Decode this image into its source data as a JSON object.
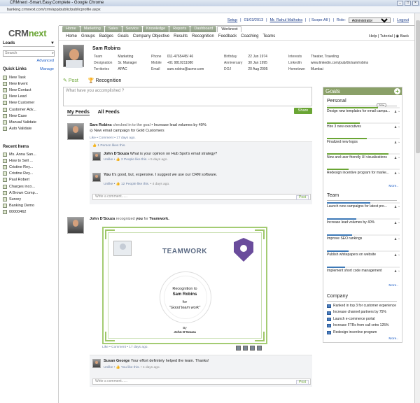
{
  "window": {
    "title": "CRMnext -Smart.Easy.Complete - Google Chrome",
    "url": "banking.crmnext.com/crm/app/public/publicprofile.aspx"
  },
  "toplinks": {
    "setup": "Setup",
    "date": "01/03/2013",
    "user": "Mr. Rahul Malhotra",
    "scope": "( Scope:All )",
    "role_label": "Role:",
    "role_value": "Administrator",
    "logout": "Logout"
  },
  "tabs": [
    "Home",
    "Marketing",
    "Sales",
    "Service",
    "Knowledge",
    "Reports",
    "Dashboard",
    "Worknext"
  ],
  "sidebar": {
    "logo_a": "CRM",
    "logo_b": "next",
    "module": "Leads",
    "search_label": "Search",
    "advanced": "Advanced",
    "quick_links_title": "Quick Links",
    "manage": "Manage",
    "quick_links": [
      "New Task",
      "New Event",
      "New Contact",
      "New Lead",
      "New Customer",
      "Customer Adv...",
      "New Case",
      "Manual Validate",
      "Auto Validate"
    ],
    "recent_title": "Recent Items",
    "recent_items": [
      "Ms. Anna San...",
      "How to Sell ...",
      "Cristine Rey...",
      "Cristine Rey...",
      "Paul Robert",
      "Charges inco...",
      "A Brown Comp...",
      "Survey",
      "Banking Demo",
      "00000462"
    ]
  },
  "nav": {
    "items": [
      "Home",
      "Groups",
      "Badges",
      "Goals",
      "Company Objective",
      "Results",
      "Recognition",
      "Feedback",
      "Coaching",
      "Teams"
    ],
    "help": "Help",
    "tutorial": "Tutorial",
    "back": "Back"
  },
  "profile": {
    "name": "Sam Robins",
    "fields1": [
      [
        "Team",
        "Marketing"
      ],
      [
        "Designation",
        "Sr. Manager"
      ],
      [
        "Territories",
        "APAC"
      ]
    ],
    "fields2": [
      [
        "Phone",
        "011-4765445/ 46"
      ],
      [
        "Mobile",
        "+91 9810211080"
      ],
      [
        "Email",
        "sam.robins@acme.com"
      ]
    ],
    "fields3": [
      [
        "Birthday",
        "22 Jun 1974"
      ],
      [
        "Anniversary",
        "30 Jan 1995"
      ],
      [
        "DOJ",
        "20 Aug 2005"
      ]
    ],
    "fields4": [
      [
        "Interests",
        "Theater, Traveling"
      ],
      [
        "LinkedIn",
        "www.linkedin.com/pub/dir/sam/robins"
      ],
      [
        "Hometown",
        "Mumbai"
      ]
    ]
  },
  "post": {
    "tab_post": "Post",
    "tab_recognition": "Recognition",
    "placeholder": "What have you accomplished ?",
    "share": "Share"
  },
  "feedtabs": {
    "my": "My Feeds",
    "all": "All Feeds"
  },
  "feed1": {
    "author": "Sam Robins",
    "action": "checked in to the goal",
    "goal": "Increase lead volumes by 40%",
    "sub": "New email campaign for Gold Customers",
    "meta": "Like • Comment • 17 days ago.",
    "likes": "1 Person likes this.",
    "c1_author": "John D'Souza",
    "c1_text": "What is your opinion on Hub Spot's email strategy?",
    "c1_meta_a": "Unlike •",
    "c1_meta_b": "2 People like this.",
    "c1_meta_c": "• 5 days ago.",
    "c2_author": "You",
    "c2_text": "It's good, but, expensive. I suggest we use our CRM software.",
    "c2_meta_a": "Unlike •",
    "c2_meta_b": "12 People like this.",
    "c2_meta_c": "• 4 days ago.",
    "write": "Write a comment......",
    "post": "Post"
  },
  "feed2": {
    "author": "John D'Souza",
    "action_a": "recognized",
    "you": "you",
    "action_b": "for",
    "badge": "Teamwork.",
    "cert_title": "TEAMWORK",
    "cert_rec": "Recognition to",
    "cert_name": "Sam Robins",
    "cert_for": "for",
    "cert_reason": "\"Good team work\"",
    "cert_by": "By",
    "cert_byname": "John D'Souza",
    "meta": "Like • Comment • 17 days ago.",
    "c1_author": "Susan George",
    "c1_text": "Your effort definitely helped the team. Thanks!",
    "c1_meta_a": "Unlike •",
    "c1_meta_b": "You like this.",
    "c1_meta_c": "• 4 days ago.",
    "write": "Write a comment......",
    "post": "Post"
  },
  "goals": {
    "title": "Goals",
    "personal_title": "Personal",
    "personal_badge": "70%",
    "personal": [
      {
        "label": "Design new templates for email campa...",
        "progress": 0.7
      },
      {
        "label": "Hire 3 new executives",
        "progress": 0.45
      },
      {
        "label": "Finalized new logos",
        "progress": 0.55
      },
      {
        "label": "New and user friendly UI visualizations",
        "progress": 0.85
      },
      {
        "label": "Redesign incentive program for marke...",
        "progress": 0.3
      }
    ],
    "more1": "More..",
    "team_title": "Team",
    "team": [
      {
        "label": "Launch new campaigns for latest pro...",
        "progress": 0.6
      },
      {
        "label": "Increase lead volumes by 40%",
        "progress": 0.4
      },
      {
        "label": "Improve SEO rankings",
        "progress": 0.35
      },
      {
        "label": "Publish whitepapers on website",
        "progress": 0.3
      },
      {
        "label": "Implement short code management",
        "progress": 0.25
      }
    ],
    "more2": "More..",
    "company_title": "Company",
    "company": [
      "Ranked in top 3 for customer experience",
      "Increase channel partners by 75%",
      "Launch e-commerce portal",
      "Increase FTRs from call cntrs 125%",
      "Redesign incentive program"
    ],
    "more3": "More.."
  }
}
